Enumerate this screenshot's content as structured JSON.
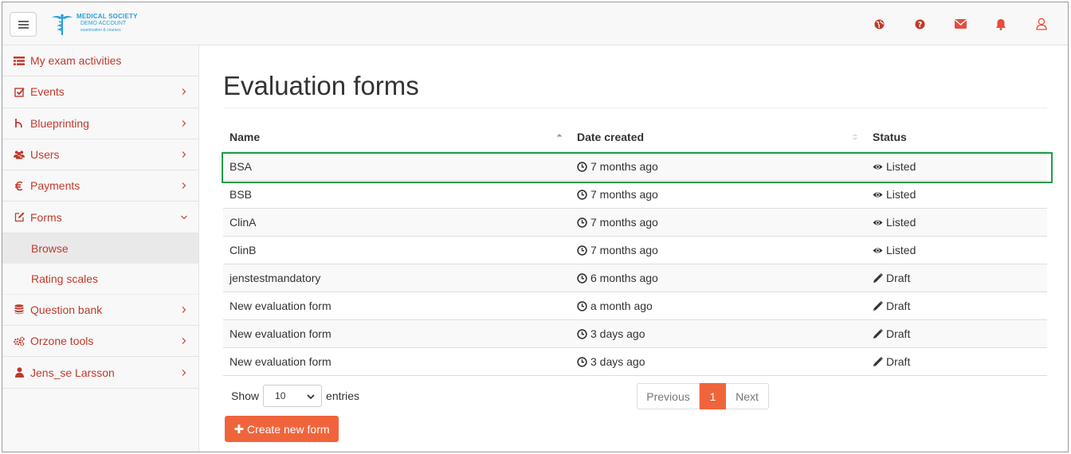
{
  "header": {
    "logo": {
      "line1": "MEDICAL SOCIETY",
      "line2": "DEMO ACCOUNT",
      "line3": "examination & courses"
    },
    "icons": [
      "globe-icon",
      "help-icon",
      "mail-icon",
      "bell-icon",
      "user-icon"
    ],
    "accent_color": "#e74c3c"
  },
  "sidebar": {
    "items": [
      {
        "label": "My exam activities",
        "icon": "list-icon",
        "has_chevron": false
      },
      {
        "label": "Events",
        "icon": "check-square-icon",
        "has_chevron": true
      },
      {
        "label": "Blueprinting",
        "icon": "blueprint-icon",
        "has_chevron": true
      },
      {
        "label": "Users",
        "icon": "users-icon",
        "has_chevron": true
      },
      {
        "label": "Payments",
        "icon": "euro-icon",
        "has_chevron": true
      },
      {
        "label": "Forms",
        "icon": "edit-icon",
        "has_chevron": true,
        "expanded": true,
        "children": [
          {
            "label": "Browse",
            "active": true
          },
          {
            "label": "Rating scales",
            "active": false
          }
        ]
      },
      {
        "label": "Question bank",
        "icon": "database-icon",
        "has_chevron": true
      },
      {
        "label": "Orzone tools",
        "icon": "cogs-icon",
        "has_chevron": true
      },
      {
        "label": "Jens_se Larsson",
        "icon": "person-icon",
        "has_chevron": true
      }
    ],
    "link_color": "#c0392b"
  },
  "main": {
    "title": "Evaluation forms",
    "table": {
      "columns": [
        "Name",
        "Date created",
        "Status"
      ],
      "rows": [
        {
          "name": "BSA",
          "date": "7 months ago",
          "status": "Listed"
        },
        {
          "name": "BSB",
          "date": "7 months ago",
          "status": "Listed"
        },
        {
          "name": "ClinA",
          "date": "7 months ago",
          "status": "Listed"
        },
        {
          "name": "ClinB",
          "date": "7 months ago",
          "status": "Listed"
        },
        {
          "name": "jenstestmandatory",
          "date": "6 months ago",
          "status": "Draft"
        },
        {
          "name": "New evaluation form",
          "date": "a month ago",
          "status": "Draft"
        },
        {
          "name": "New evaluation form",
          "date": "3 days ago",
          "status": "Draft"
        },
        {
          "name": "New evaluation form",
          "date": "3 days ago",
          "status": "Draft"
        }
      ],
      "highlighted_row": 0,
      "highlight_color": "#1f9d47"
    },
    "length_menu": {
      "show_label": "Show",
      "value": "10",
      "entries_label": "entries"
    },
    "pagination": {
      "previous": "Previous",
      "current": "1",
      "next": "Next"
    },
    "create_button": {
      "icon": "plus-icon",
      "label": "Create new form",
      "color": "#f0643c"
    }
  }
}
